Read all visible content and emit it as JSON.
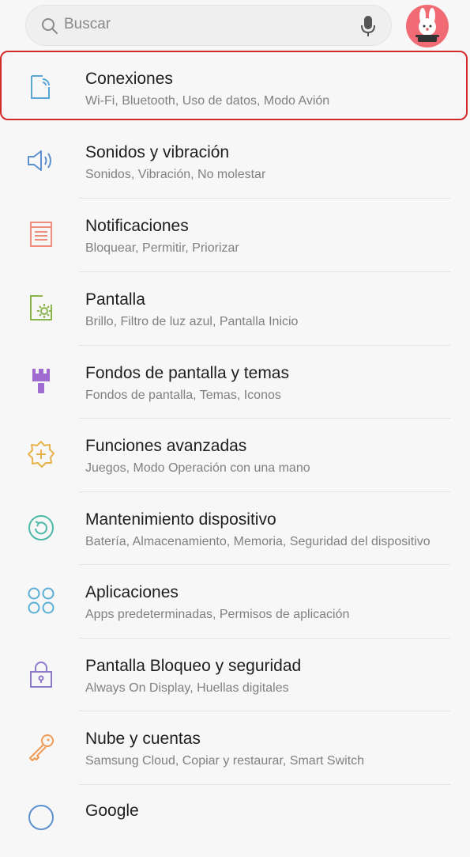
{
  "search": {
    "placeholder": "Buscar"
  },
  "items": [
    {
      "title": "Conexiones",
      "subtitle": "Wi-Fi, Bluetooth, Uso de datos, Modo Avión",
      "icon": "connections-icon"
    },
    {
      "title": "Sonidos y vibración",
      "subtitle": "Sonidos, Vibración, No molestar",
      "icon": "speaker-icon"
    },
    {
      "title": "Notificaciones",
      "subtitle": "Bloquear, Permitir, Priorizar",
      "icon": "notifications-icon"
    },
    {
      "title": "Pantalla",
      "subtitle": "Brillo, Filtro de luz azul, Pantalla Inicio",
      "icon": "display-icon"
    },
    {
      "title": "Fondos de pantalla y temas",
      "subtitle": "Fondos de pantalla, Temas, Iconos",
      "icon": "paintbrush-icon"
    },
    {
      "title": "Funciones avanzadas",
      "subtitle": "Juegos, Modo Operación con una mano",
      "icon": "gear-plus-icon"
    },
    {
      "title": "Mantenimiento dispositivo",
      "subtitle": "Batería, Almacenamiento, Memoria, Seguridad del dispositivo",
      "icon": "refresh-icon"
    },
    {
      "title": "Aplicaciones",
      "subtitle": "Apps predeterminadas, Permisos de aplicación",
      "icon": "apps-icon"
    },
    {
      "title": "Pantalla Bloqueo y seguridad",
      "subtitle": "Always On Display, Huellas digitales",
      "icon": "lock-icon"
    },
    {
      "title": "Nube y cuentas",
      "subtitle": "Samsung Cloud, Copiar y restaurar, Smart Switch",
      "icon": "key-icon"
    },
    {
      "title": "Google",
      "subtitle": "",
      "icon": "google-icon"
    }
  ],
  "colors": {
    "highlight": "#d32a2a",
    "connections": "#5aa6d6",
    "sound": "#5b8fd0",
    "notifications": "#ef8e7a",
    "display": "#8ab54a",
    "wallpaper": "#9e6cd0",
    "advanced": "#e8b24a",
    "maintenance": "#4cb8a8",
    "apps": "#5aaed8",
    "lock": "#8e7acb",
    "cloud": "#ef9a55"
  }
}
